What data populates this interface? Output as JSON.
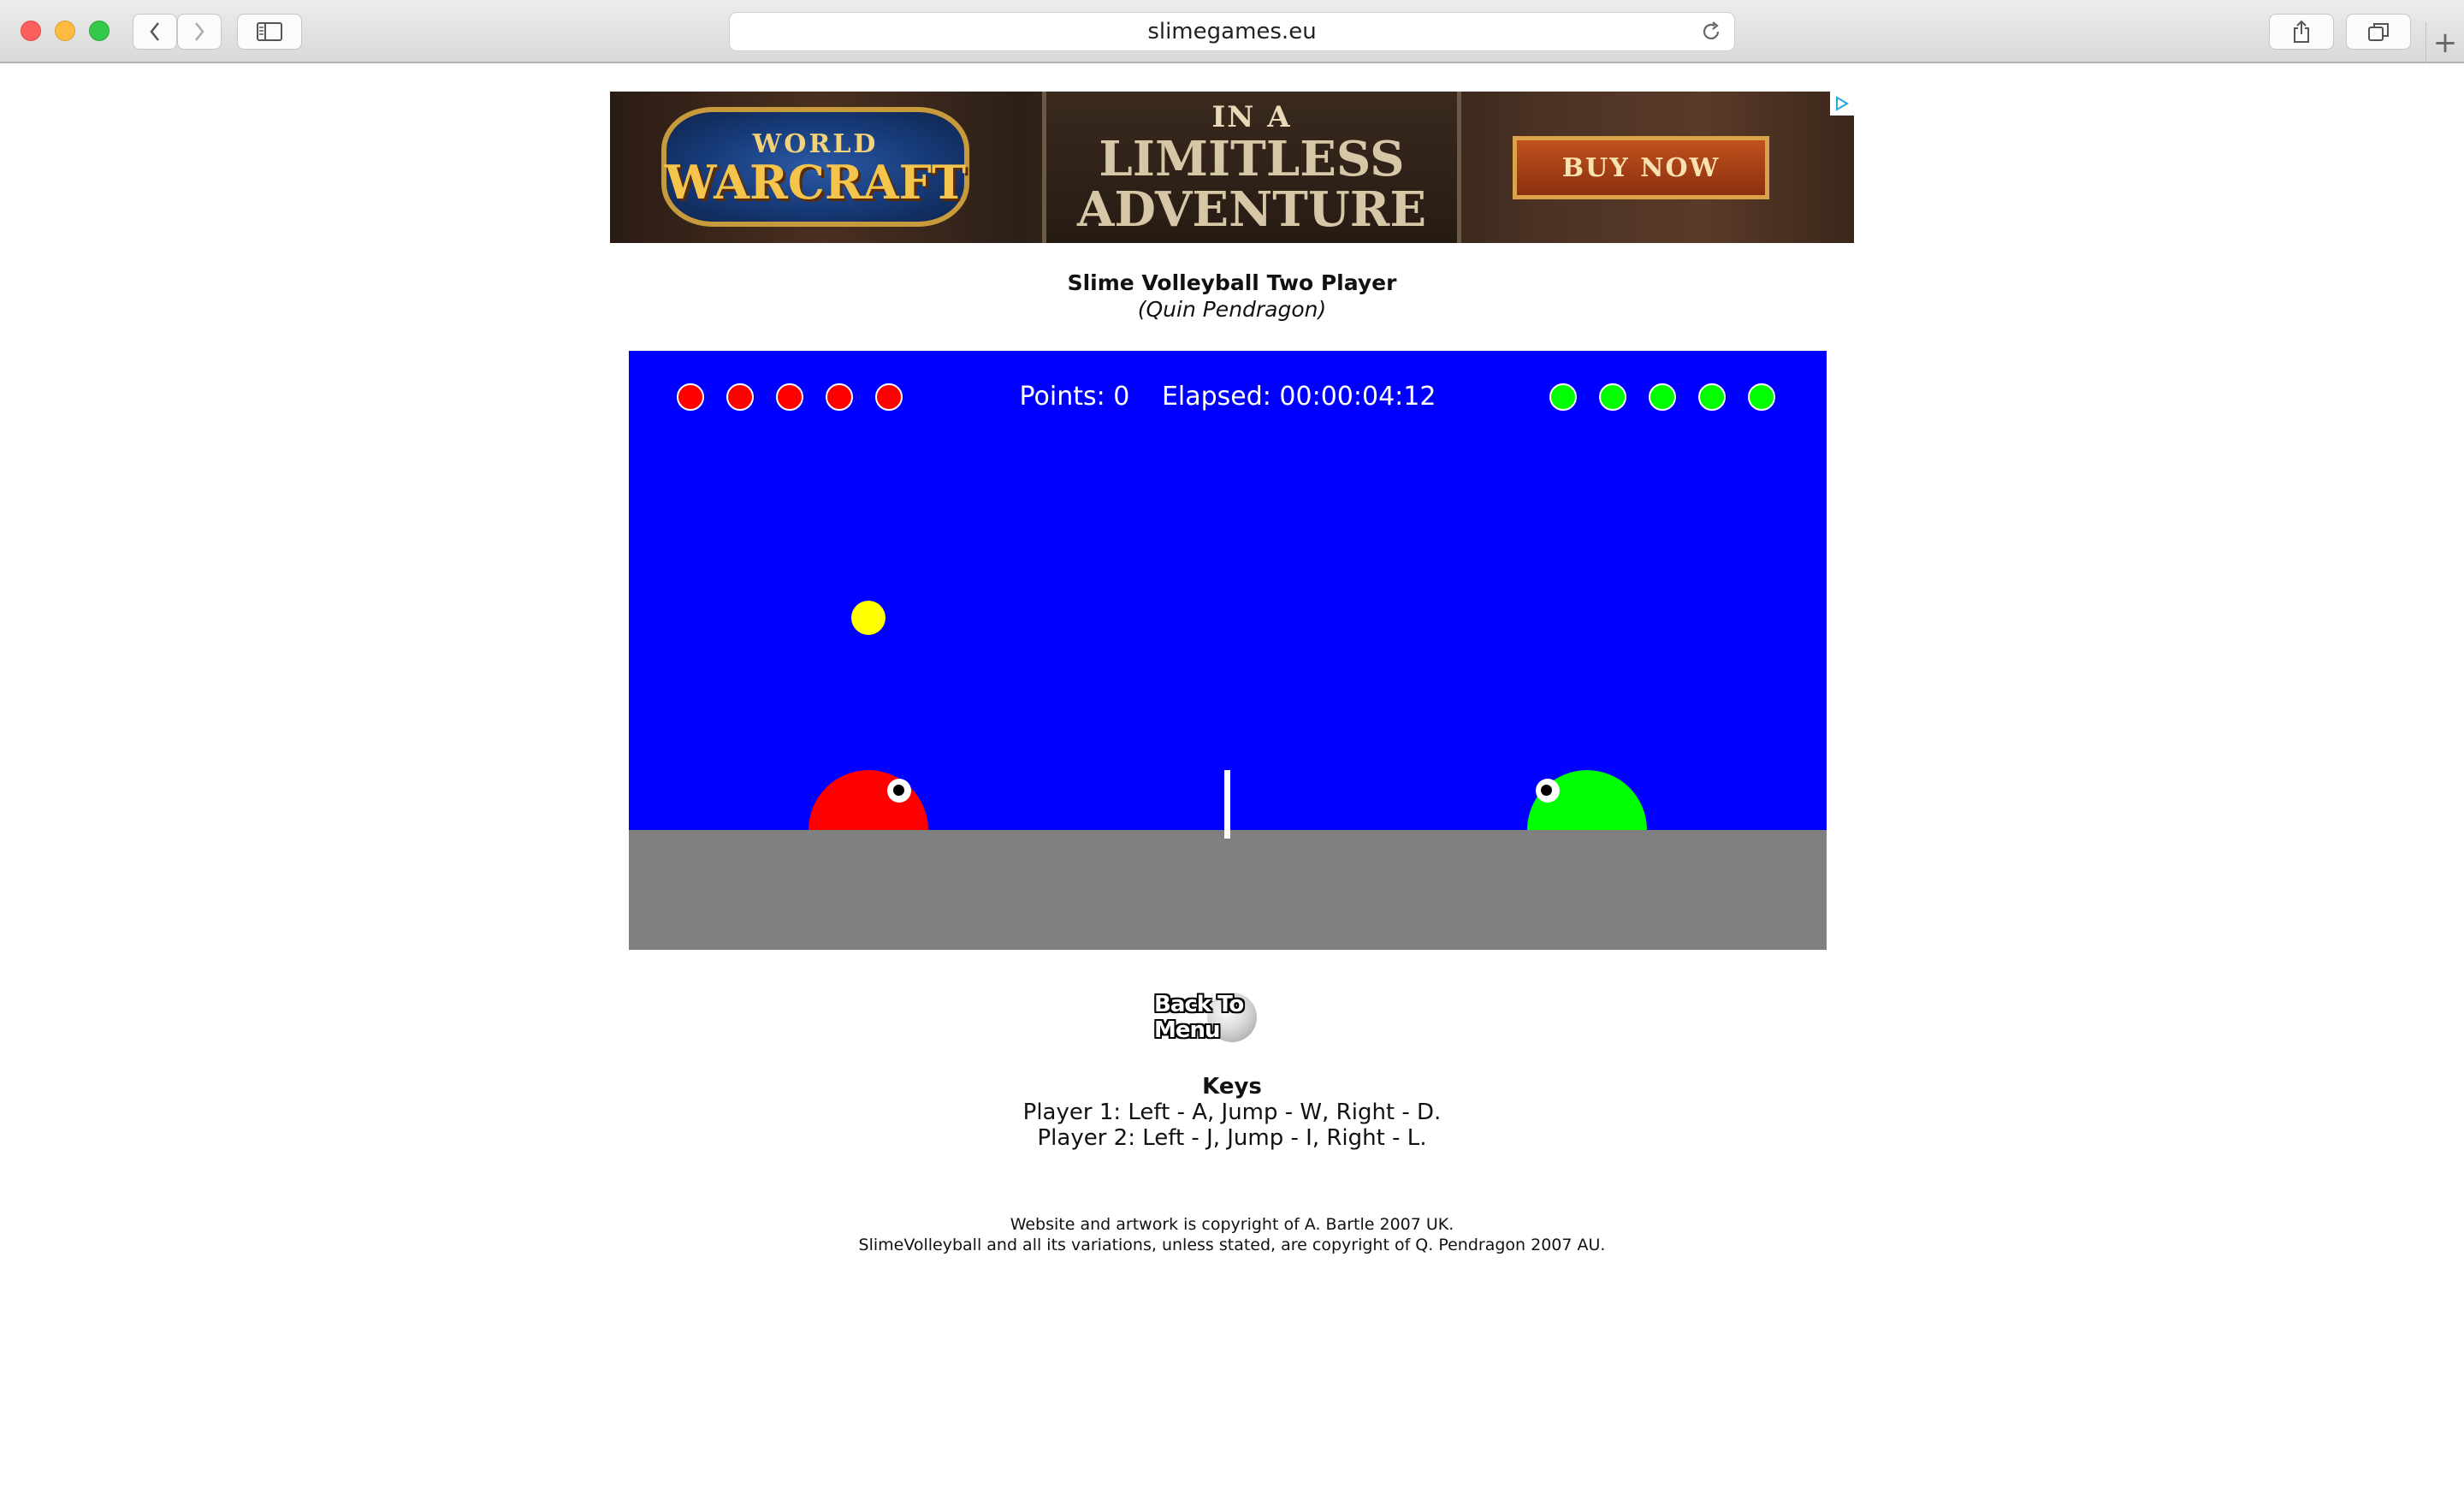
{
  "browser": {
    "url": "slimegames.eu",
    "new_tab_label": "+"
  },
  "ad": {
    "logo_top": "WORLD",
    "logo_main": "WARCRAFT",
    "line1": "IN A",
    "line2": "LIMITLESS",
    "line3": "ADVENTURE",
    "cta": "BUY NOW"
  },
  "page": {
    "title": "Slime Volleyball Two Player",
    "subtitle": "(Quin Pendragon)"
  },
  "game": {
    "points_text": "Points: 0",
    "elapsed_text": "Elapsed: 00:00:04:12",
    "player1_lives": 5,
    "player2_lives": 5,
    "colors": {
      "sky": "#0000ff",
      "ground": "#808080",
      "player1": "#ff0000",
      "player2": "#00ff00",
      "ball": "#ffff00"
    }
  },
  "back_button": {
    "label": "Back To Menu"
  },
  "keys": {
    "heading": "Keys",
    "player1": "Player 1: Left - A, Jump - W, Right - D.",
    "player2": "Player 2: Left - J, Jump - I, Right - L."
  },
  "footer": {
    "line1": "Website and artwork is copyright of A. Bartle 2007 UK.",
    "line2": "SlimeVolleyball and all its variations, unless stated, are copyright of Q. Pendragon 2007 AU."
  }
}
